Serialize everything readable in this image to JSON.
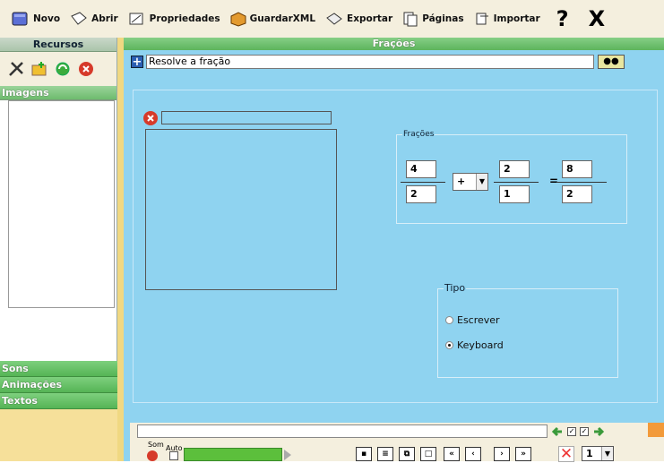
{
  "toolbar": {
    "novo": "Novo",
    "abrir": "Abrir",
    "propriedades": "Propriedades",
    "guardarxml": "GuardarXML",
    "exportar": "Exportar",
    "paginas": "Páginas",
    "importar": "Importar",
    "help": "?",
    "close": "X"
  },
  "left": {
    "header": "Recursos",
    "sections": {
      "imagens": "Imagens",
      "sons": "Sons",
      "animacoes": "Animações",
      "textos": "Textos"
    }
  },
  "main": {
    "title": "Frações",
    "prompt": "Resolve a fração",
    "fractions": {
      "legend": "Frações",
      "a_num": "4",
      "a_den": "2",
      "operator": "+",
      "b_num": "2",
      "b_den": "1",
      "equals": "=",
      "r_num": "8",
      "r_den": "2"
    },
    "tipo": {
      "legend": "Tipo",
      "options": [
        "Escrever",
        "Keyboard"
      ],
      "selected": "Keyboard"
    }
  },
  "bottom": {
    "som_label": "Som",
    "auto_label": "Auto",
    "page": "1"
  }
}
